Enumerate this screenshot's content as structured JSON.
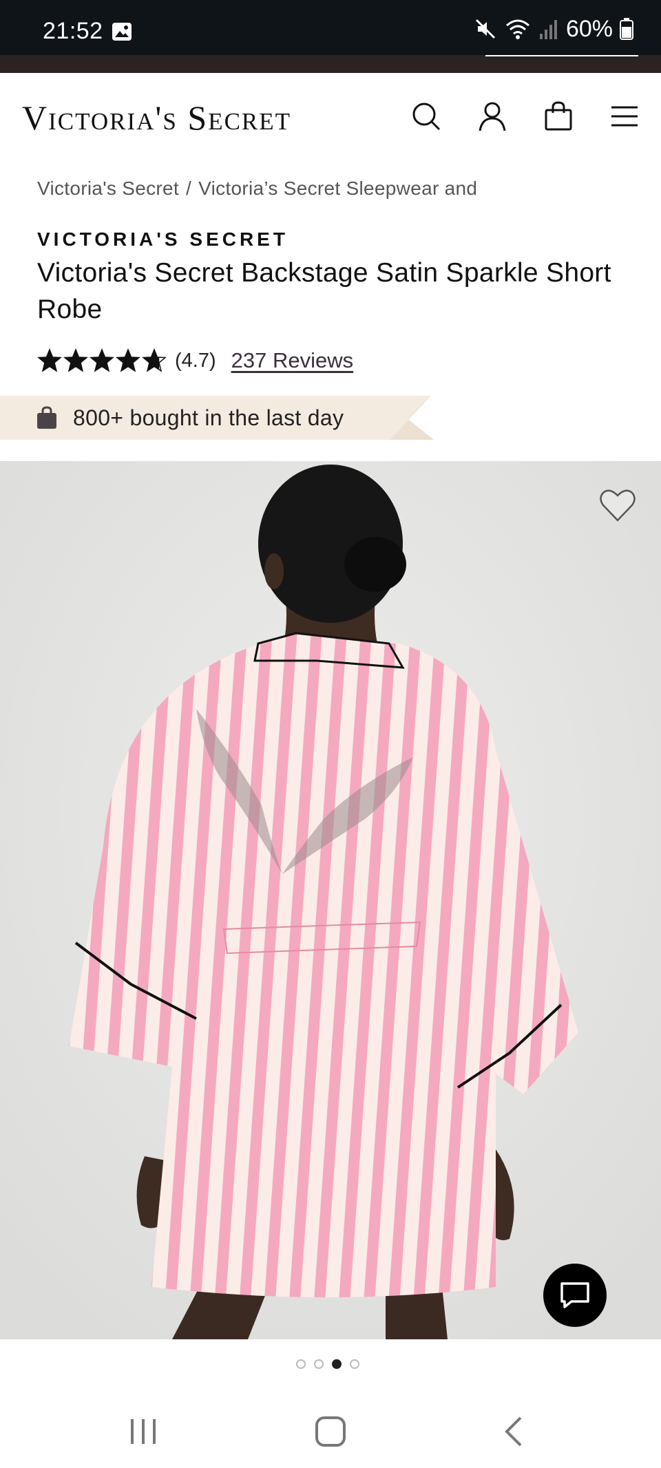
{
  "status_bar": {
    "time": "21:52",
    "battery": "60%",
    "icons": [
      "gallery-icon",
      "mute-icon",
      "wifi-icon",
      "signal-icon",
      "battery-icon"
    ]
  },
  "header": {
    "logo": "Victoria's Secret",
    "icons": [
      "search-icon",
      "account-icon",
      "bag-icon",
      "menu-icon"
    ]
  },
  "breadcrumb": {
    "items": [
      "Victoria's Secret",
      "Victoria’s Secret Sleepwear and"
    ],
    "separator": "/"
  },
  "product": {
    "brand": "VICTORIA'S SECRET",
    "title": "Victoria's Secret Backstage Satin Sparkle Short Robe",
    "rating_value": 4.7,
    "rating_text": "(4.7)",
    "reviews": "237 Reviews",
    "bought_text": "800+ bought in the last day"
  },
  "gallery": {
    "total_images": 4,
    "active_index": 2
  },
  "colors": {
    "status_bg": "#0f1419",
    "banner_bg": "#f4ebe0",
    "robe_pink": "#f4a9bf",
    "robe_cream": "#fbece7"
  }
}
